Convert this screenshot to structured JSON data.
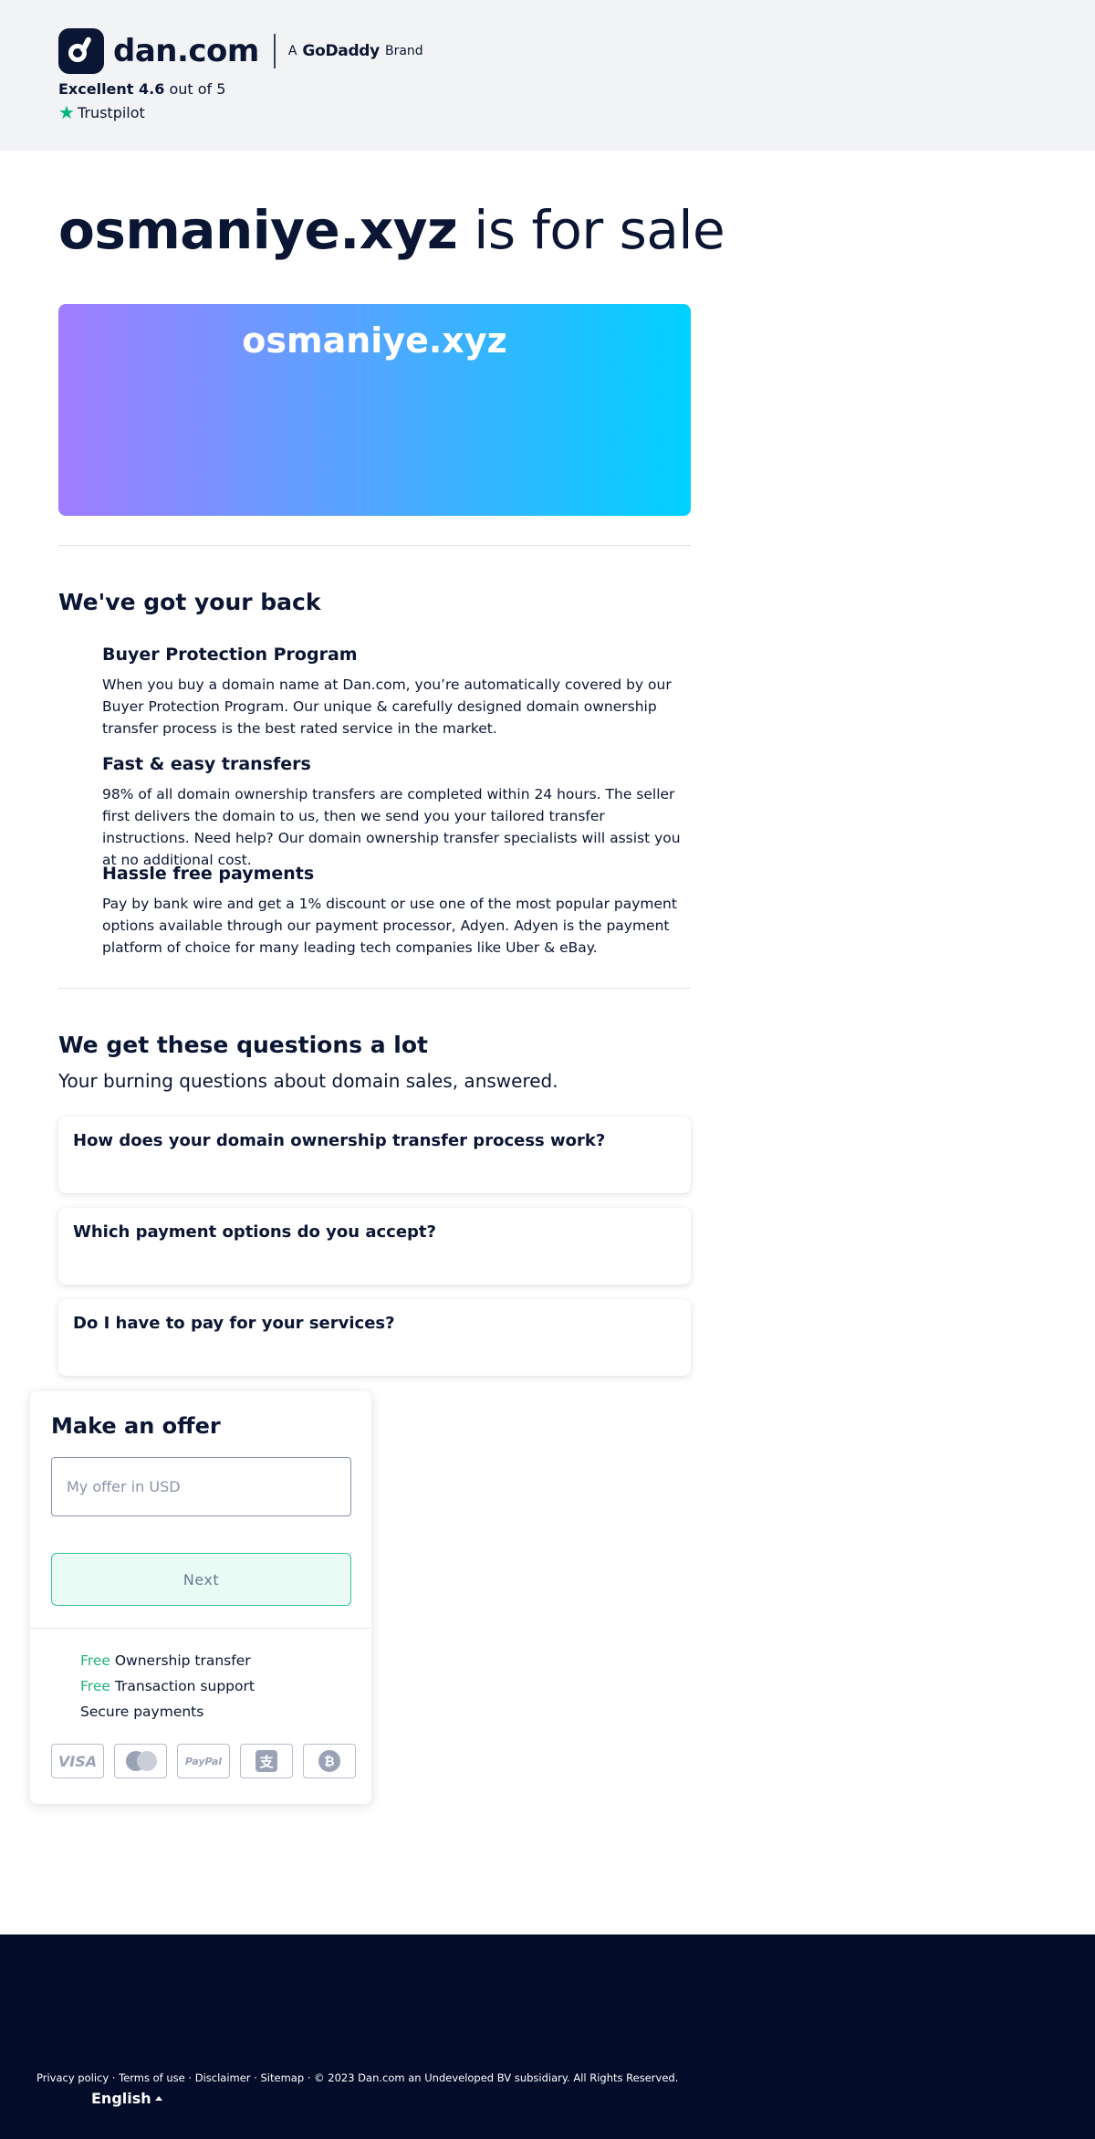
{
  "header": {
    "logo_text": "dan.com",
    "brand_prefix": "A",
    "brand_name": "GoDaddy",
    "brand_suffix": "Brand",
    "rating_word": "Excellent 4.6",
    "rating_suffix": "out of 5",
    "trustpilot": "Trustpilot"
  },
  "title": {
    "domain": "osmaniye.xyz",
    "rest": " is for sale"
  },
  "banner": {
    "domain": "osmaniye.xyz",
    "gradient_start": "#a17cff",
    "gradient_end": "#00d1ff"
  },
  "back_section": {
    "heading": "We've got your back",
    "features": [
      {
        "title": "Buyer Protection Program",
        "text": "When you buy a domain name at Dan.com, you’re automatically covered by our Buyer Protection Program. Our unique & carefully designed domain ownership transfer process is the best rated service in the market."
      },
      {
        "title": "Fast & easy transfers",
        "text": "98% of all domain ownership transfers are completed within 24 hours. The seller first delivers the domain to us, then we send you your tailored transfer instructions. Need help? Our domain ownership transfer specialists will assist you at no additional cost."
      },
      {
        "title": "Hassle free payments",
        "text": "Pay by bank wire and get a 1% discount or use one of the most popular payment options available through our payment processor, Adyen. Adyen is the payment platform of choice for many leading tech companies like Uber & eBay."
      }
    ]
  },
  "faq": {
    "heading": "We get these questions a lot",
    "subheading": "Your burning questions about domain sales, answered.",
    "questions": [
      "How does your domain ownership transfer process work?",
      "Which payment options do you accept?",
      "Do I have to pay for your services?"
    ]
  },
  "offer": {
    "title": "Make an offer",
    "input_placeholder": "My offer in USD",
    "next_label": "Next",
    "perks": [
      {
        "free": "Free",
        "text": " Ownership transfer"
      },
      {
        "free": "Free",
        "text": " Transaction support"
      },
      {
        "free": "",
        "text": "Secure payments"
      }
    ],
    "payment_icons": [
      "visa-icon",
      "mastercard-icon",
      "paypal-icon",
      "alipay-icon",
      "bitcoin-icon"
    ],
    "visa_text": "VISA",
    "paypal_text": "PayPal",
    "alipay_glyph": "支",
    "bitcoin_glyph": "₿"
  },
  "footer": {
    "links": [
      "Privacy policy",
      "Terms of use",
      "Disclaimer",
      "Sitemap"
    ],
    "separator": " · ",
    "copyright": "© 2023 Dan.com an Undeveloped BV subsidiary. All Rights Reserved.",
    "language": "English"
  },
  "colors": {
    "accent_green": "#21b17a",
    "navy": "#0a1633",
    "footer_bg": "#030d2a"
  }
}
